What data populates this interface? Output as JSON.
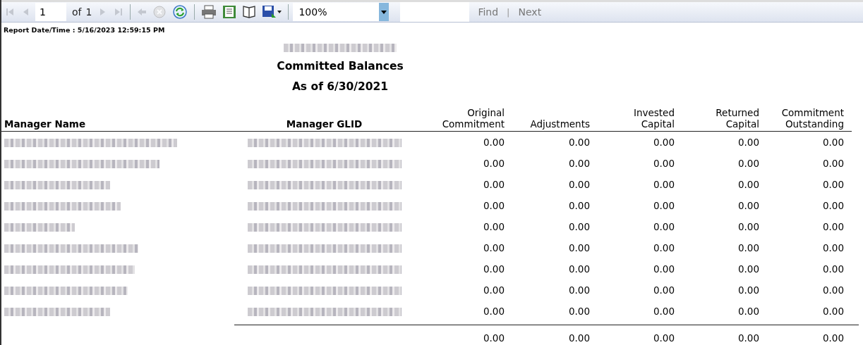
{
  "toolbar": {
    "page": "1",
    "of_label": "of",
    "page_count": "1",
    "nav_buttons": [
      {
        "kind": "first",
        "disabled": true
      },
      {
        "kind": "previous",
        "disabled": true
      },
      {
        "kind": "next",
        "disabled": true
      },
      {
        "kind": "last",
        "disabled": true
      }
    ],
    "action_buttons": [
      {
        "kind": "back",
        "disabled": true
      },
      {
        "kind": "stop",
        "disabled": true
      },
      {
        "kind": "refresh",
        "disabled": false
      }
    ],
    "zoom": "100%",
    "find_label": "Find",
    "separator": "|",
    "next_label": "Next"
  },
  "report": {
    "timestamp": "Report Date/Time : 5/16/2023 12:59:15 PM",
    "organization_redacted": true,
    "title": "Committed Balances",
    "subtitle": "As of 6/30/2021",
    "columns": [
      "Manager Name",
      "Manager GLID",
      "Original\nCommitment",
      "Adjustments",
      "Invested\nCapital",
      "Returned\nCapital",
      "Commitment\nOutstanding"
    ],
    "rows": [
      {
        "name_redacted": true,
        "glid_redacted": true,
        "values": [
          "0.00",
          "0.00",
          "0.00",
          "0.00",
          "0.00"
        ]
      },
      {
        "name_redacted": true,
        "glid_redacted": true,
        "values": [
          "0.00",
          "0.00",
          "0.00",
          "0.00",
          "0.00"
        ]
      },
      {
        "name_redacted": true,
        "glid_redacted": true,
        "values": [
          "0.00",
          "0.00",
          "0.00",
          "0.00",
          "0.00"
        ]
      },
      {
        "name_redacted": true,
        "glid_redacted": true,
        "values": [
          "0.00",
          "0.00",
          "0.00",
          "0.00",
          "0.00"
        ]
      },
      {
        "name_redacted": true,
        "glid_redacted": true,
        "values": [
          "0.00",
          "0.00",
          "0.00",
          "0.00",
          "0.00"
        ]
      },
      {
        "name_redacted": true,
        "glid_redacted": true,
        "values": [
          "0.00",
          "0.00",
          "0.00",
          "0.00",
          "0.00"
        ]
      },
      {
        "name_redacted": true,
        "glid_redacted": true,
        "values": [
          "0.00",
          "0.00",
          "0.00",
          "0.00",
          "0.00"
        ]
      },
      {
        "name_redacted": true,
        "glid_redacted": true,
        "values": [
          "0.00",
          "0.00",
          "0.00",
          "0.00",
          "0.00"
        ]
      },
      {
        "name_redacted": true,
        "glid_redacted": true,
        "values": [
          "0.00",
          "0.00",
          "0.00",
          "0.00",
          "0.00"
        ]
      }
    ],
    "totals": [
      "0.00",
      "0.00",
      "0.00",
      "0.00",
      "0.00"
    ]
  }
}
